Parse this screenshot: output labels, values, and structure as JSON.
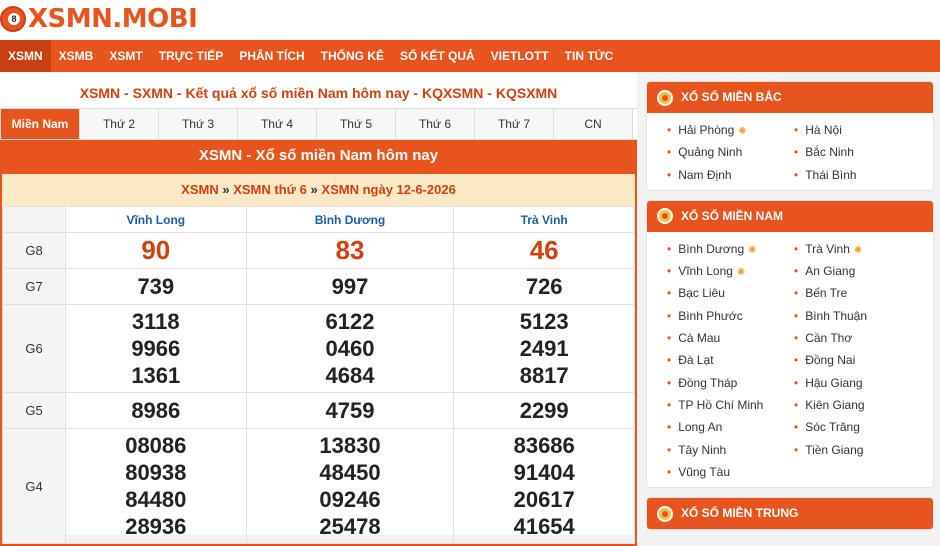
{
  "logo": {
    "text": "XSMN.MOBI"
  },
  "nav": [
    "XSMN",
    "XSMB",
    "XSMT",
    "TRỰC TIẾP",
    "PHÂN TÍCH",
    "THỐNG KÊ",
    "SỔ KẾT QUẢ",
    "VIETLOTT",
    "TIN TỨC"
  ],
  "page_title": "XSMN - SXMN - Kết quả xổ số miền Nam hôm nay - KQXSMN - KQSXMN",
  "tabs": [
    "Miền Nam",
    "Thứ 2",
    "Thứ 3",
    "Thứ 4",
    "Thứ 5",
    "Thứ 6",
    "Thứ 7",
    "CN"
  ],
  "result": {
    "heading": "XSMN - Xổ số miền Nam hôm nay",
    "crumb": [
      "XSMN",
      "»",
      "XSMN thứ 6",
      "»",
      "XSMN ngày 12-6-2026"
    ],
    "provinces": [
      "Vĩnh Long",
      "Bình Dương",
      "Trà Vinh"
    ],
    "rows": [
      {
        "label": "G8",
        "values": [
          [
            "90"
          ],
          [
            "83"
          ],
          [
            "46"
          ]
        ]
      },
      {
        "label": "G7",
        "values": [
          [
            "739"
          ],
          [
            "997"
          ],
          [
            "726"
          ]
        ]
      },
      {
        "label": "G6",
        "values": [
          [
            "3118",
            "9966",
            "1361"
          ],
          [
            "6122",
            "0460",
            "4684"
          ],
          [
            "5123",
            "2491",
            "8817"
          ]
        ]
      },
      {
        "label": "G5",
        "values": [
          [
            "8986"
          ],
          [
            "4759"
          ],
          [
            "2299"
          ]
        ]
      },
      {
        "label": "G4",
        "values": [
          [
            "08086",
            "80938",
            "84480",
            "28936"
          ],
          [
            "13830",
            "48450",
            "09246",
            "25478"
          ],
          [
            "83686",
            "91404",
            "20617",
            "41654"
          ]
        ]
      }
    ]
  },
  "sidebar": {
    "mien_bac": {
      "title": "XỔ SỐ MIỀN BẮC",
      "items": [
        "Hải Phòng",
        "Hà Nội",
        "Quảng Ninh",
        "Bắc Ninh",
        "Nam Định",
        "Thái Bình"
      ]
    },
    "mien_nam": {
      "title": "XỔ SỐ MIỀN NAM",
      "items": [
        "Bình Dương",
        "Trà Vinh",
        "Vĩnh Long",
        "An Giang",
        "Bạc Liêu",
        "Bến Tre",
        "Bình Phước",
        "Bình Thuận",
        "Cà Mau",
        "Cần Thơ",
        "Đà Lạt",
        "Đồng Nai",
        "Đồng Tháp",
        "Hậu Giang",
        "TP Hồ Chí Minh",
        "Kiên Giang",
        "Long An",
        "Sóc Trăng",
        "Tây Ninh",
        "Tiền Giang",
        "Vũng Tàu"
      ]
    },
    "mien_trung": {
      "title": "XỔ SỐ MIỀN TRUNG"
    }
  },
  "live_icon": "✺",
  "colors": {
    "accent": "#e8541e",
    "crumb_bg": "#fbe8c6",
    "province": "#1a5fa8"
  }
}
